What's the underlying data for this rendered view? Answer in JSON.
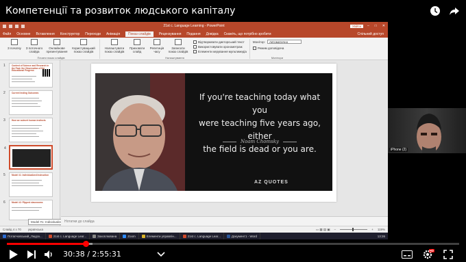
{
  "player": {
    "title": "Компетенції та розвиток людського капіталу",
    "current_time": "30:38",
    "duration": "2:55:31",
    "progress_fraction": 0.1745,
    "loaded_fraction": 0.19,
    "hd_badge": "HD"
  },
  "ppt": {
    "doc_title": "21st c. Language Learning  -  PowerPoint",
    "account": "Увійти",
    "tabs": [
      "Файл",
      "Основне",
      "Вставлення",
      "Конструктор",
      "Переходи",
      "Анімація",
      "Показ слайдів",
      "Рецензування",
      "Подання",
      "Довідка",
      "Скажіть, що потрібно зробити"
    ],
    "active_tab_index": 6,
    "share": "Спільний доступ",
    "ribbon": {
      "start_group_label": "Почати показ слайдів",
      "start_buttons": [
        "З початку",
        "З поточного слайда",
        "Онлайнове презентування",
        "Користувацький показ слайдів"
      ],
      "setup_group_label": "Налаштування",
      "setup_buttons": [
        "Налаштувати показ слайдів",
        "Приховати слайд",
        "Репетиція часу",
        "Записати показ слайдів"
      ],
      "checkboxes": [
        "Відтворювати дикторський текст",
        "Використовувати хронометраж",
        "Елементи керування мультимедіа"
      ],
      "monitors_group_label": "Монітори",
      "monitor_label": "Монітор:",
      "monitor_value": "Автоматично",
      "presenter_view": "Режим доповідача"
    },
    "thumbnails": [
      {
        "num": "1",
        "title": "Context of Science and Research in the Past: the Observation of the Educational Progress"
      },
      {
        "num": "2",
        "title": "Current testing Outcomes"
      },
      {
        "num": "3",
        "title": "How we subvert human instincts"
      },
      {
        "num": "4",
        "title": ""
      },
      {
        "num": "5",
        "title": "Model #1: Individualized Instruction"
      },
      {
        "num": "6",
        "title": "Model #2: Flipped classrooms"
      }
    ],
    "thumb_tooltip": "Model #1: Individualized Instructi...",
    "quote": {
      "line1": "If you're teaching today what you",
      "line2": "were teaching five years ago, either",
      "line3": "the field is dead or you are.",
      "author": "Noam Chomsky",
      "brand": "AZ QUOTES"
    },
    "notes_placeholder": "Нотатки до слайда",
    "status": {
      "slide_info": "Слайд 4 з 70",
      "language": "українська",
      "zoom": "119%"
    },
    "taskbar": [
      "Потапчовський_Людск...",
      "21st c. Language Lear...",
      "Захоплювана",
      "Zoom",
      "Елементи управлін...",
      "21st c. Language Lear...",
      "Документ1 - Word"
    ],
    "tray_time": "13:26"
  },
  "camera": {
    "participant": "iPhone (2)"
  },
  "colors": {
    "ppt_accent": "#b7472a",
    "progress_red": "#ff0000"
  }
}
